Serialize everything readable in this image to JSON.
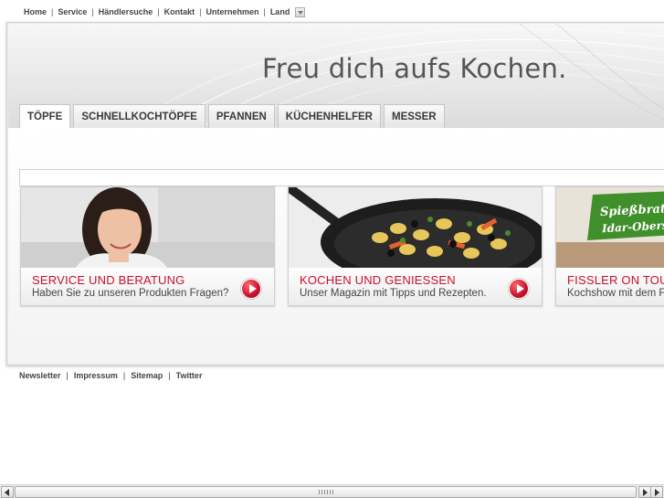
{
  "top_nav": {
    "items": [
      "Home",
      "Service",
      "Händlersuche",
      "Kontakt",
      "Unternehmen",
      "Land"
    ],
    "separator": "|"
  },
  "header": {
    "slogan": "Freu dich aufs Kochen."
  },
  "tabs": [
    "TÖPFE",
    "SCHNELLKOCHTÖPFE",
    "PFANNEN",
    "KÜCHENHELFER",
    "MESSER"
  ],
  "cards": [
    {
      "title": "SERVICE UND BERATUNG",
      "subtitle": "Haben Sie zu unseren Produkten Fragen?",
      "image_icon": "woman-portrait-icon"
    },
    {
      "title": "KOCHEN UND GENIESSEN",
      "subtitle": "Unser Magazin mit Tipps und Rezepten.",
      "image_icon": "pan-food-icon"
    },
    {
      "title": "FISSLER ON TOU",
      "subtitle": "Kochshow mit dem F",
      "image_text_1": "Spießbrate",
      "image_text_2": "Idar-Oberste",
      "image_icon": "roast-banner-icon"
    }
  ],
  "footer_nav": {
    "items": [
      "Newsletter",
      "Impressum",
      "Sitemap",
      "Twitter"
    ],
    "separator": "|"
  },
  "colors": {
    "accent_red": "#c8102e",
    "text_dark": "#444444",
    "banner_green": "#3f8f2a"
  }
}
